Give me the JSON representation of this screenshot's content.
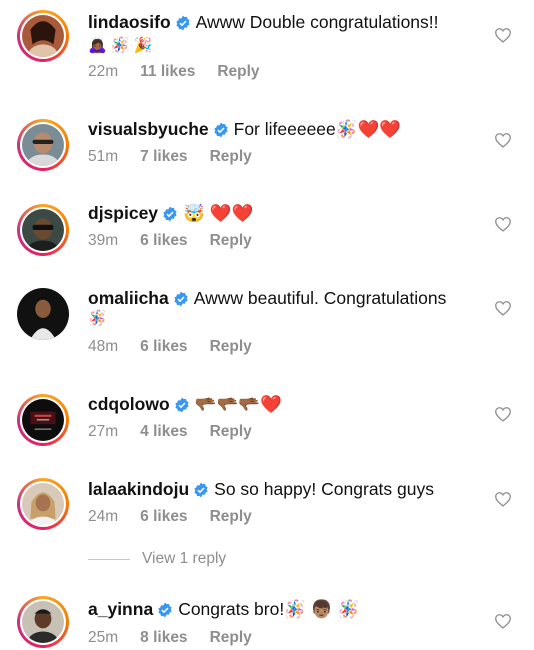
{
  "comments": [
    {
      "username": "lindaosifo",
      "text": "Awww Double congratulations!!",
      "emojis": "🙇🏾‍♀️ 🪅 🎉",
      "time": "22m",
      "likes": "11 likes",
      "reply": "Reply",
      "story_ring": true
    },
    {
      "username": "visualsbyuche",
      "text": "For lifeeeeee🪅❤️❤️",
      "time": "51m",
      "likes": "7 likes",
      "reply": "Reply",
      "story_ring": true
    },
    {
      "username": "djspicey",
      "text": "🤯 ❤️❤️",
      "time": "39m",
      "likes": "6 likes",
      "reply": "Reply",
      "story_ring": true
    },
    {
      "username": "omaliicha",
      "text": "Awww beautiful. Congratulations",
      "emojis": "🪅",
      "time": "48m",
      "likes": "6 likes",
      "reply": "Reply",
      "story_ring": false
    },
    {
      "username": "cdqolowo",
      "text": "🫳🏾🫳🏾🫳🏾❤️",
      "time": "27m",
      "likes": "4 likes",
      "reply": "Reply",
      "story_ring": true
    },
    {
      "username": "lalaakindoju",
      "text": "So so happy! Congrats guys",
      "time": "24m",
      "likes": "6 likes",
      "reply": "Reply",
      "story_ring": true
    },
    {
      "username": "a_yinna",
      "text": "Congrats bro!🪅 👦🏽 🪅",
      "time": "25m",
      "likes": "8 likes",
      "reply": "Reply",
      "story_ring": true
    }
  ],
  "view_replies": "View 1 reply",
  "colors": {
    "verified": "#3897f0",
    "meta_gray": "#8e8e8e",
    "heart_outline": "#8e8e8e"
  },
  "icons": {
    "verified": "verified-badge-icon",
    "like": "heart-outline-icon"
  }
}
